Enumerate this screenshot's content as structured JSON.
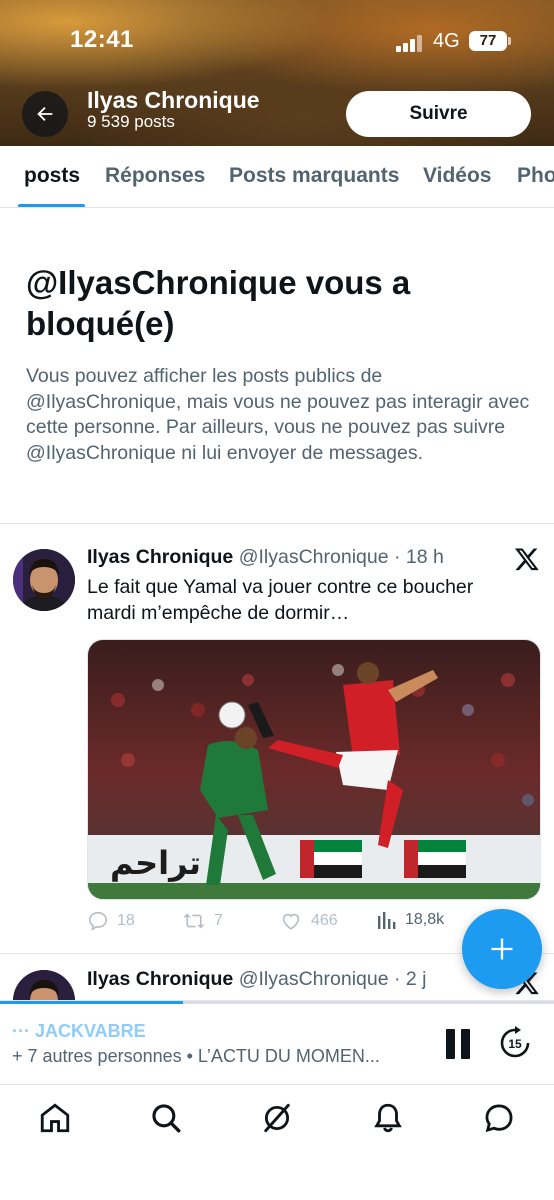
{
  "status_bar": {
    "time": "12:41",
    "network": "4G",
    "battery": "77"
  },
  "profile": {
    "name": "Ilyas Chronique",
    "posts_count": "9 539 posts",
    "follow_label": "Suivre"
  },
  "tabs": [
    {
      "label": "posts",
      "active": true
    },
    {
      "label": "Réponses",
      "active": false
    },
    {
      "label": "Posts marquants",
      "active": false
    },
    {
      "label": "Vidéos",
      "active": false
    },
    {
      "label": "Pho",
      "active": false
    }
  ],
  "blocked": {
    "title": "@IlyasChronique vous a bloqué(e)",
    "text": "Vous pouvez afficher les posts publics de @IlyasChronique, mais vous ne pouvez pas interagir avec cette personne. Par ailleurs, vous ne pouvez pas suivre @IlyasChronique ni lui envoyer de messages."
  },
  "tweets": [
    {
      "name": "Ilyas Chronique",
      "meta": "@IlyasChronique · 18 h",
      "text": "Le fait que Yamal va jouer contre ce boucher mardi m’empêche de dormir…",
      "stats": {
        "replies": "18",
        "reposts": "7",
        "likes": "466",
        "views": "18,8k"
      }
    },
    {
      "name": "Ilyas Chronique",
      "meta": "@IlyasChronique · 2 j"
    }
  ],
  "player": {
    "host": "··· JACKVABRE",
    "subtitle": "+ 7 autres personnes • L’ACTU DU MOMEN...",
    "progress": 0.33
  },
  "nav": [
    "home-icon",
    "search-icon",
    "grok-icon",
    "notifications-icon",
    "messages-icon"
  ],
  "colors": {
    "accent": "#1d9bf0",
    "text": "#0f1419",
    "secondary": "#536471"
  }
}
